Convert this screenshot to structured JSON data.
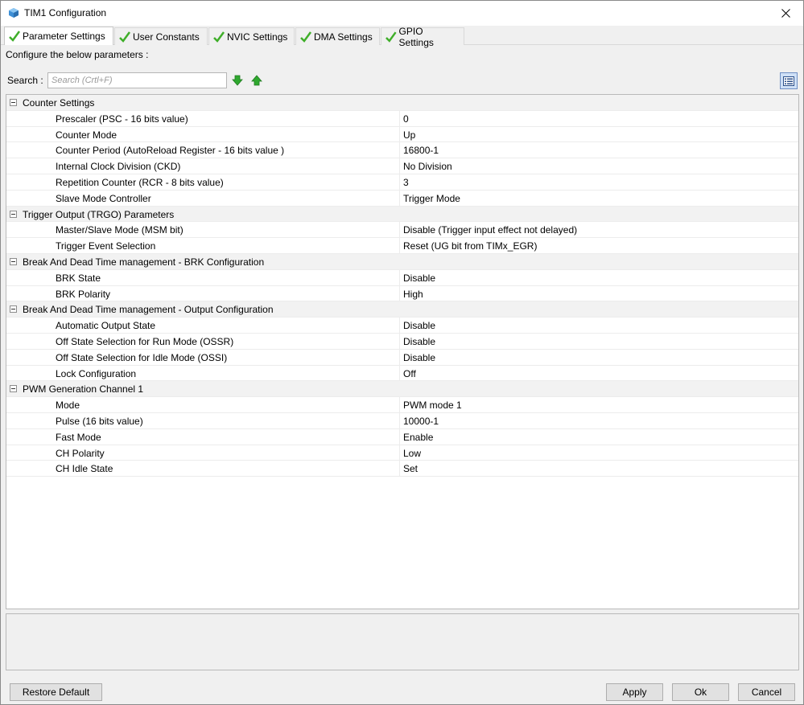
{
  "window": {
    "title": "TIM1 Configuration"
  },
  "tabs": [
    {
      "label": "Parameter Settings",
      "active": true
    },
    {
      "label": "User Constants",
      "active": false
    },
    {
      "label": "NVIC Settings",
      "active": false
    },
    {
      "label": "DMA Settings",
      "active": false
    },
    {
      "label": "GPIO Settings",
      "active": false
    }
  ],
  "subtitle": "Configure the below parameters :",
  "search": {
    "label": "Search :",
    "placeholder": "Search (Crtl+F)",
    "value": ""
  },
  "groups": [
    {
      "name": "Counter Settings",
      "params": [
        {
          "name": "Prescaler (PSC - 16 bits value)",
          "value": "0"
        },
        {
          "name": "Counter Mode",
          "value": "Up"
        },
        {
          "name": "Counter Period (AutoReload Register - 16 bits value )",
          "value": "16800-1"
        },
        {
          "name": "Internal Clock Division (CKD)",
          "value": "No Division"
        },
        {
          "name": "Repetition Counter (RCR - 8 bits value)",
          "value": "3"
        },
        {
          "name": "Slave Mode Controller",
          "value": "Trigger Mode"
        }
      ]
    },
    {
      "name": "Trigger Output (TRGO) Parameters",
      "params": [
        {
          "name": "Master/Slave Mode (MSM bit)",
          "value": "Disable (Trigger input effect not delayed)"
        },
        {
          "name": "Trigger Event Selection",
          "value": "Reset (UG bit from TIMx_EGR)"
        }
      ]
    },
    {
      "name": "Break And Dead Time management - BRK Configuration",
      "params": [
        {
          "name": "BRK State",
          "value": "Disable"
        },
        {
          "name": "BRK Polarity",
          "value": "High"
        }
      ]
    },
    {
      "name": "Break And Dead Time management - Output Configuration",
      "params": [
        {
          "name": "Automatic Output State",
          "value": "Disable"
        },
        {
          "name": "Off State Selection for Run Mode (OSSR)",
          "value": "Disable"
        },
        {
          "name": "Off State Selection for Idle Mode (OSSI)",
          "value": "Disable"
        },
        {
          "name": "Lock Configuration",
          "value": "Off"
        }
      ]
    },
    {
      "name": "PWM Generation Channel 1",
      "params": [
        {
          "name": "Mode",
          "value": "PWM mode 1"
        },
        {
          "name": "Pulse (16 bits value)",
          "value": "10000-1"
        },
        {
          "name": "Fast Mode",
          "value": "Enable"
        },
        {
          "name": "CH Polarity",
          "value": "Low"
        },
        {
          "name": "CH Idle State",
          "value": "Set"
        }
      ]
    }
  ],
  "buttons": {
    "restore_default": "Restore Default",
    "apply": "Apply",
    "ok": "Ok",
    "cancel": "Cancel"
  },
  "colors": {
    "check_green": "#3fae29",
    "arrow_green": "#2fa82f",
    "group_bg": "#f2f2f2"
  }
}
